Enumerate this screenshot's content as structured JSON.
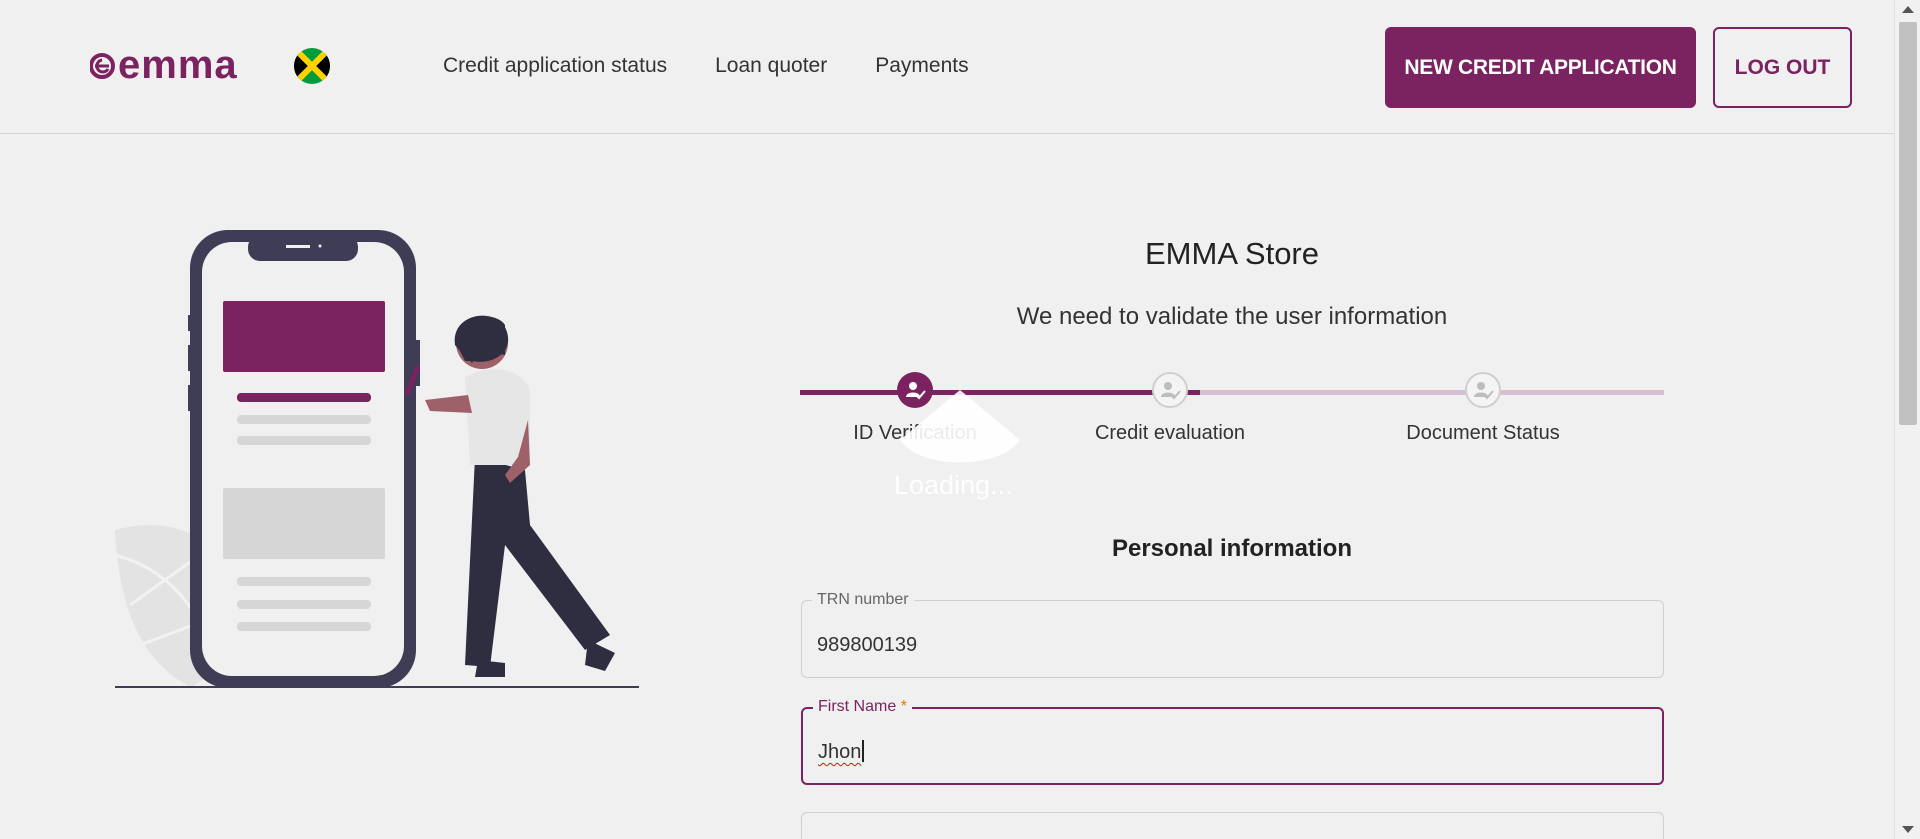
{
  "header": {
    "logo_text": "emma",
    "nav": [
      "Credit application status",
      "Loan quoter",
      "Payments"
    ],
    "new_application_label": "NEW CREDIT APPLICATION",
    "logout_label": "LOG OUT"
  },
  "colors": {
    "brand": "#7b2260",
    "brand_light": "#d6bfd0",
    "background": "#f0f0f0"
  },
  "main": {
    "store_title": "EMMA Store",
    "subtitle": "We need to validate the user information",
    "steps": [
      {
        "label": "ID Verification",
        "state": "active",
        "icon": "user-check-icon"
      },
      {
        "label": "Credit evaluation",
        "state": "inactive",
        "icon": "user-check-icon"
      },
      {
        "label": "Document Status",
        "state": "inactive",
        "icon": "user-check-icon"
      }
    ],
    "loading_text": "Loading...",
    "section_title": "Personal information",
    "fields": {
      "trn": {
        "label": "TRN number",
        "value": "989800139"
      },
      "first_name": {
        "label": "First Name",
        "required_mark": "*",
        "value": "Jhon"
      }
    }
  }
}
